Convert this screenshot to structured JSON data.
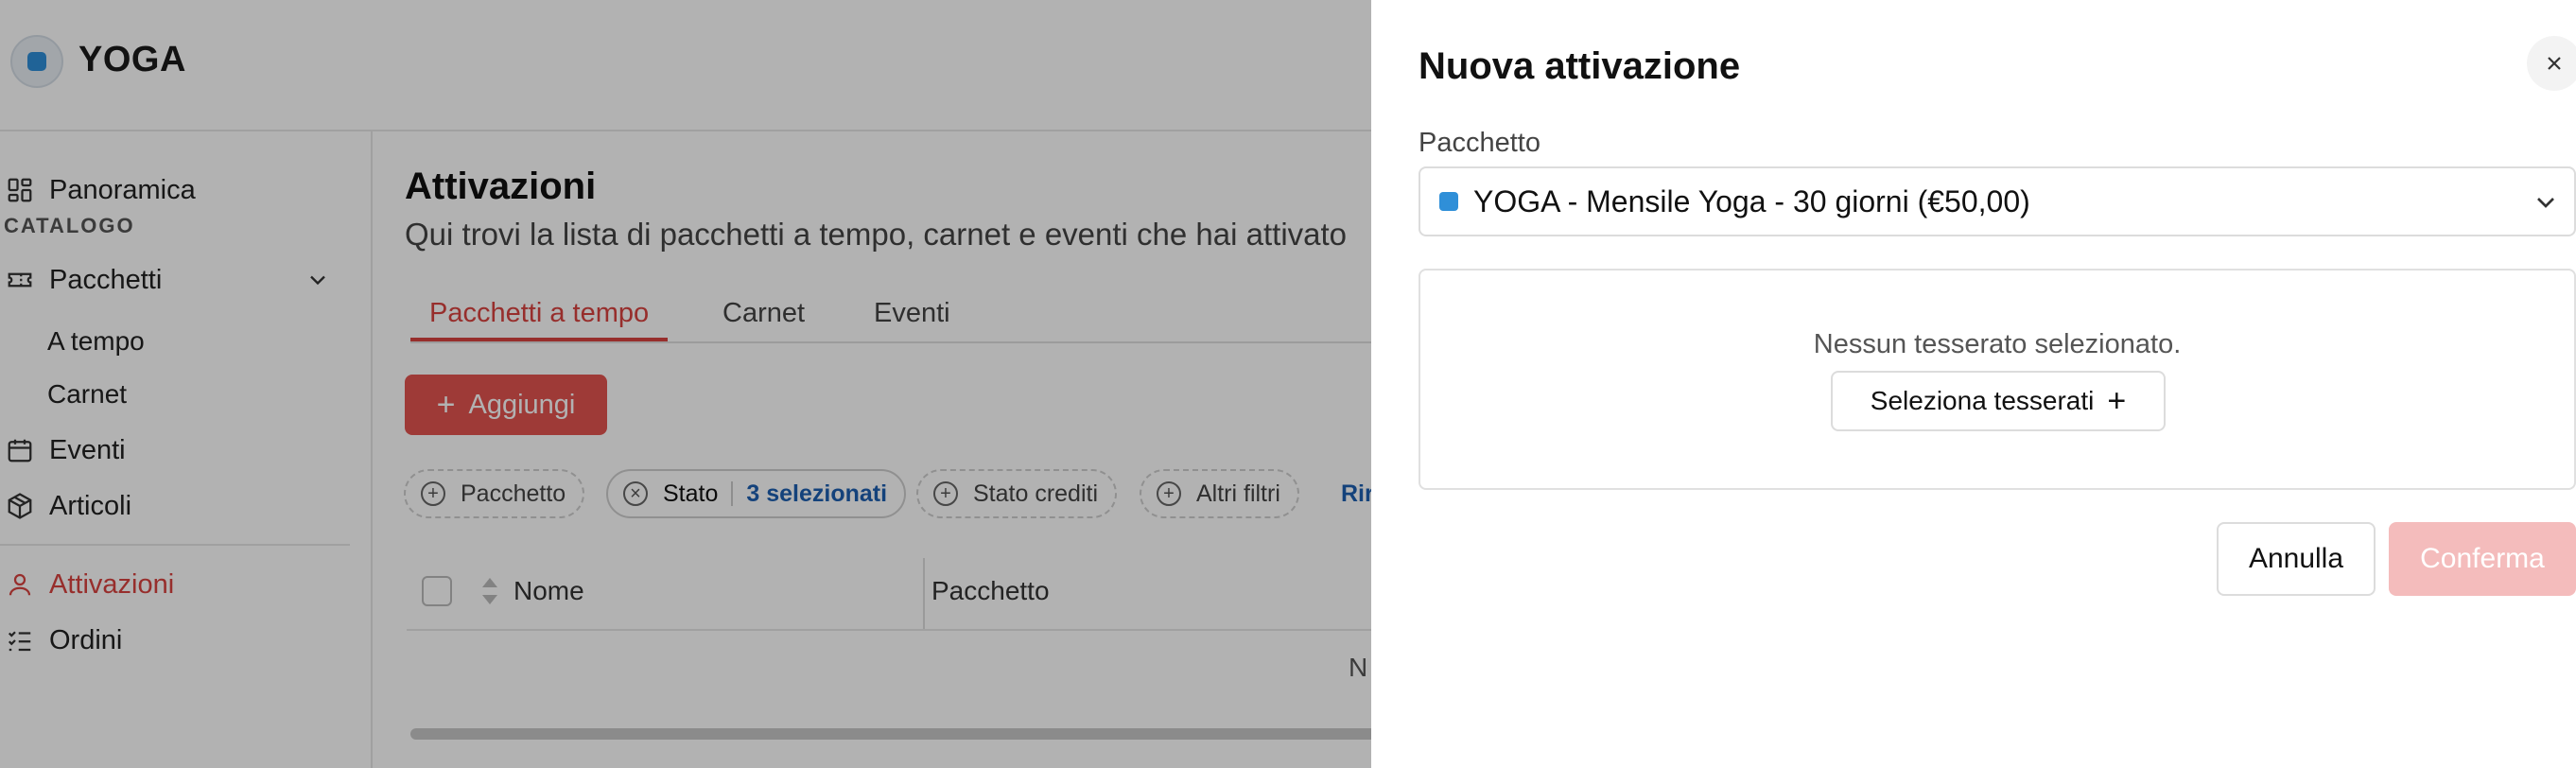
{
  "app": {
    "brand": "YOGA"
  },
  "sidebar": {
    "items": [
      {
        "label": "Panoramica",
        "icon": "dashboard-icon"
      },
      {
        "label": "Pacchetti",
        "icon": "ticket-icon"
      },
      {
        "label": "A tempo"
      },
      {
        "label": "Carnet"
      },
      {
        "label": "Eventi",
        "icon": "calendar-icon"
      },
      {
        "label": "Articoli",
        "icon": "package-icon"
      },
      {
        "label": "Attivazioni",
        "icon": "user-icon",
        "active": true
      },
      {
        "label": "Ordini",
        "icon": "checklist-icon"
      }
    ],
    "section_catalog": "CATALOGO"
  },
  "main": {
    "title": "Attivazioni",
    "subtitle": "Qui trovi la lista di pacchetti a tempo, carnet e eventi che hai attivato",
    "tabs": [
      {
        "label": "Pacchetti a tempo",
        "active": true
      },
      {
        "label": "Carnet"
      },
      {
        "label": "Eventi"
      }
    ],
    "add_label": "Aggiungi",
    "filters": [
      {
        "label": "Pacchetto"
      },
      {
        "label": "Stato",
        "value": "3 selezionati"
      },
      {
        "label": "Stato crediti"
      },
      {
        "label": "Altri filtri"
      }
    ],
    "reset_fragment": "Rir",
    "columns": [
      "Nome",
      "Pacchetto"
    ],
    "empty_fragment": "N"
  },
  "drawer": {
    "title": "Nuova attivazione",
    "package_label": "Pacchetto",
    "package_value": "YOGA - Mensile Yoga - 30 giorni (€50,00)",
    "empty_members": "Nessun tesserato selezionato.",
    "select_members_label": "Seleziona tesserati",
    "cancel_label": "Annulla",
    "confirm_label": "Conferma"
  },
  "colors": {
    "accent": "#d9433f",
    "accent_button": "#e2534f",
    "confirm_disabled": "#f4bcbc",
    "link": "#1e5fb0",
    "package_dot": "#2f8fd8"
  }
}
